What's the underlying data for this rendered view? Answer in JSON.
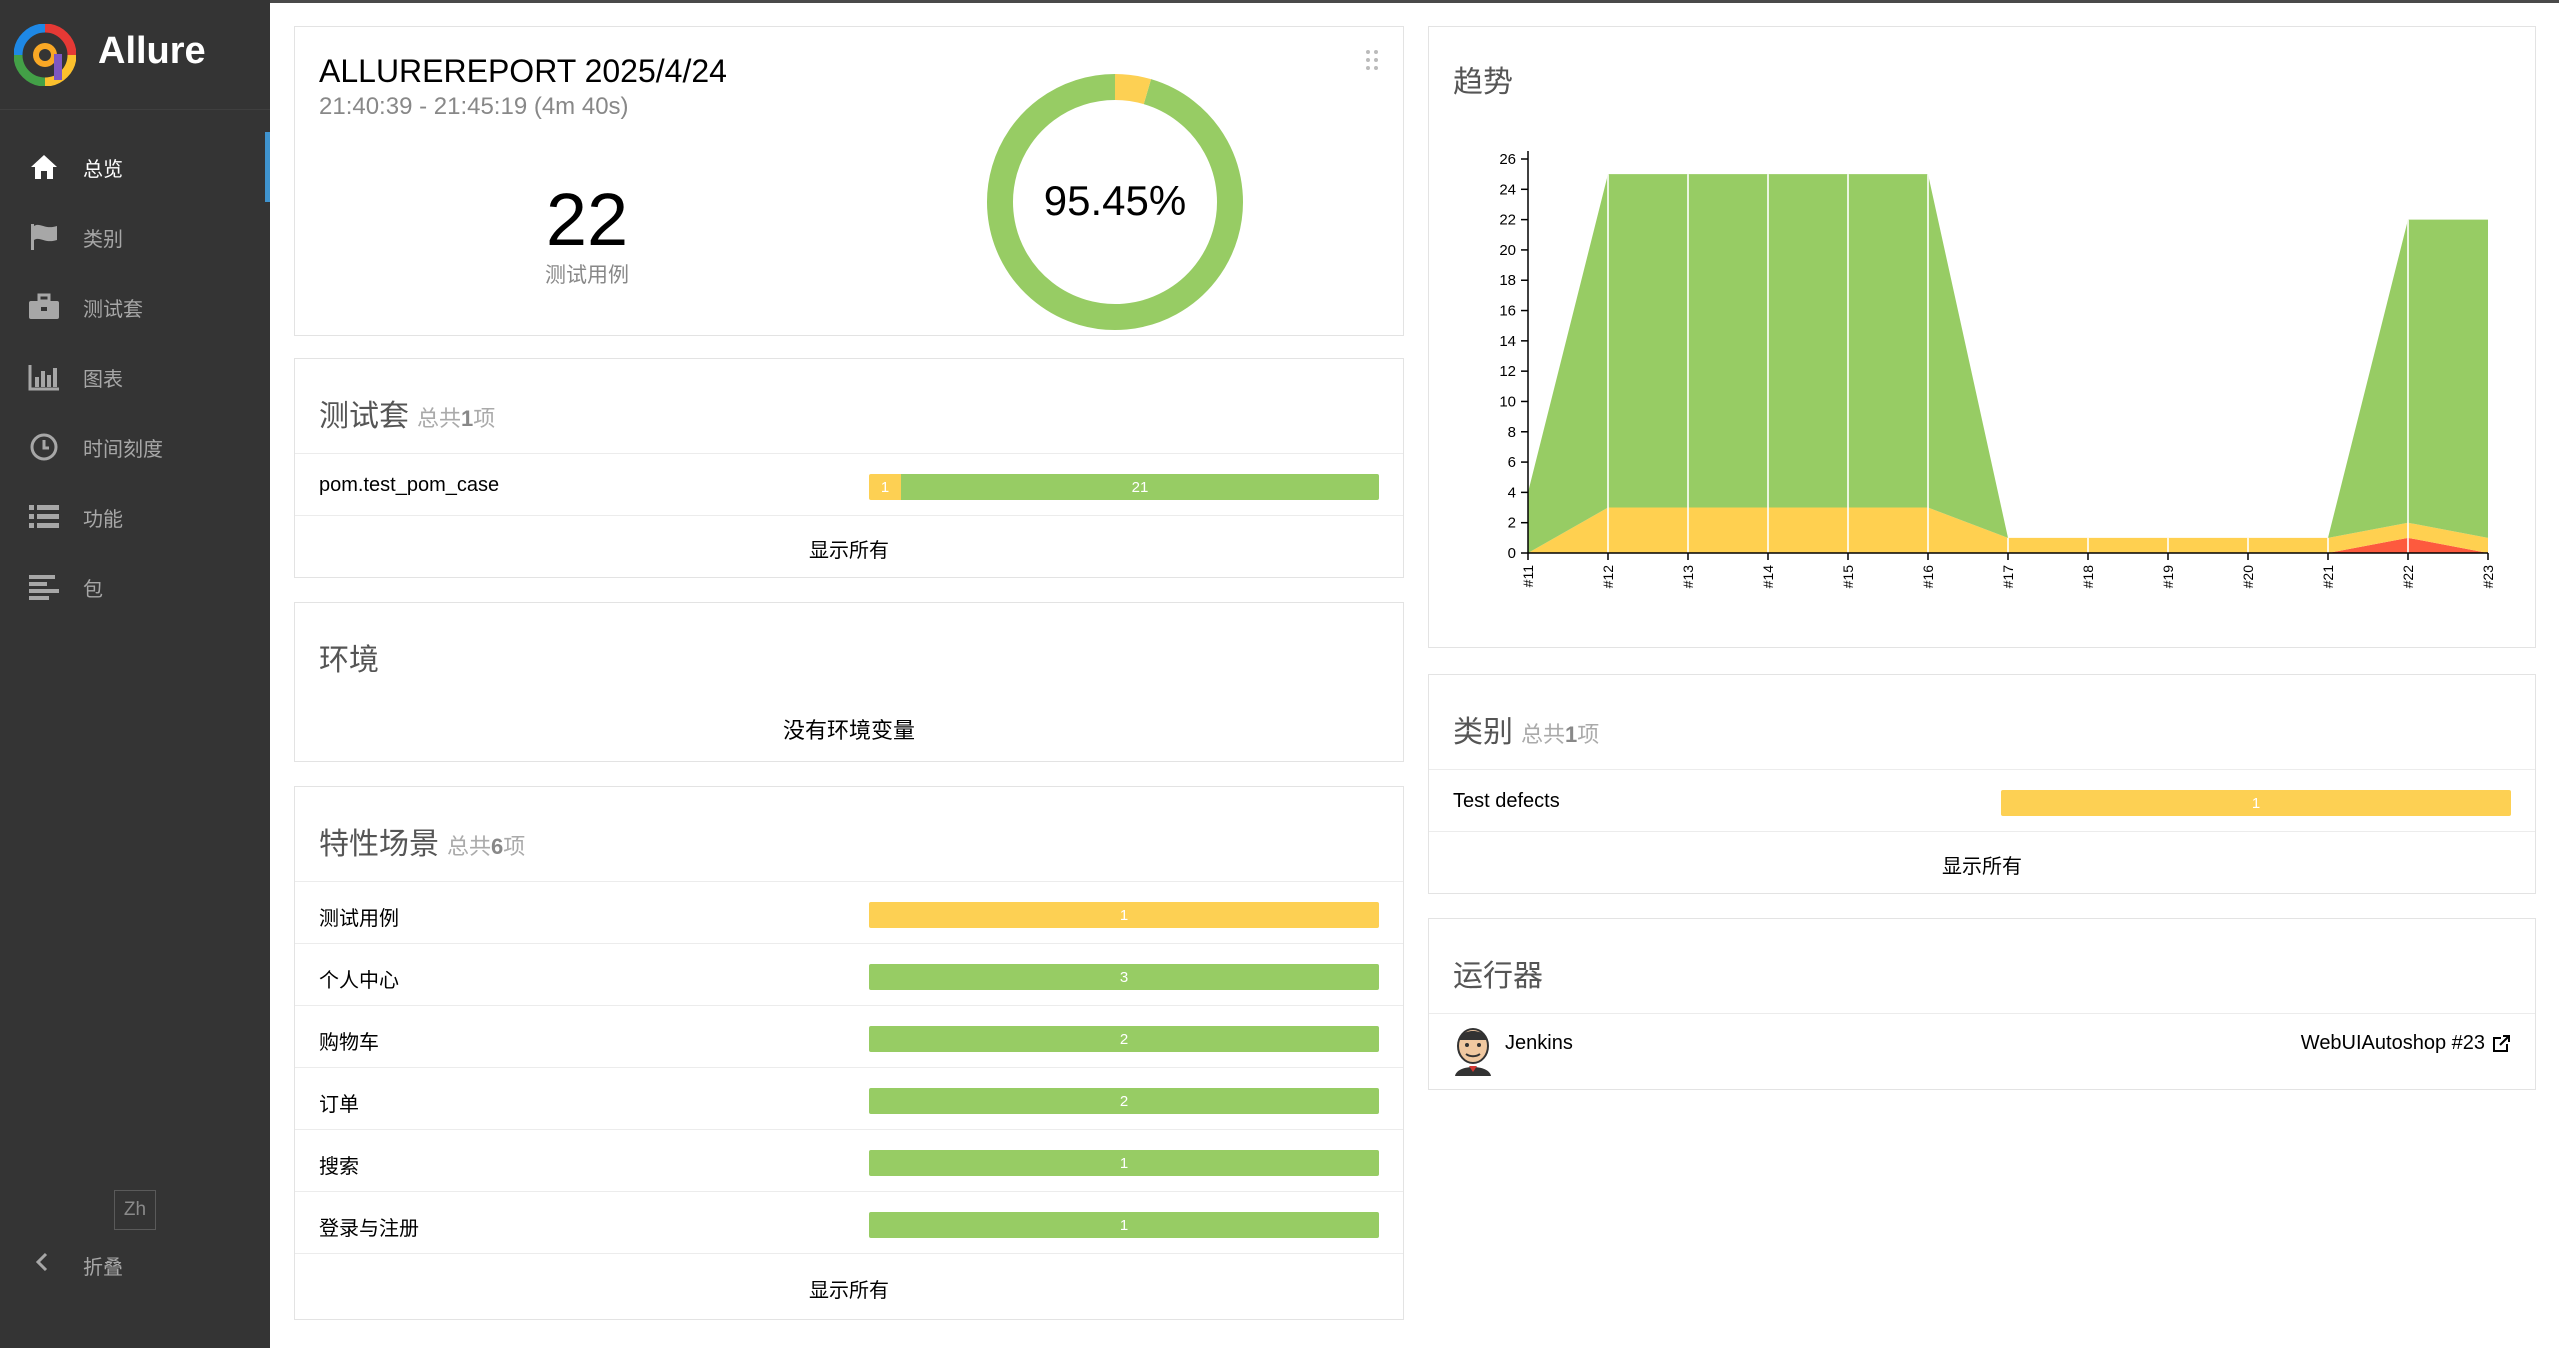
{
  "sidebar": {
    "brand": "Allure",
    "items": [
      {
        "label": "总览",
        "icon": "home-icon",
        "active": true
      },
      {
        "label": "类别",
        "icon": "flag-icon"
      },
      {
        "label": "测试套",
        "icon": "briefcase-icon"
      },
      {
        "label": "图表",
        "icon": "bar-chart-icon"
      },
      {
        "label": "时间刻度",
        "icon": "clock-icon"
      },
      {
        "label": "功能",
        "icon": "list-icon"
      },
      {
        "label": "包",
        "icon": "align-left-icon"
      }
    ],
    "language": "Zh",
    "collapse_label": "折叠"
  },
  "summary": {
    "title": "ALLUREREPORT 2025/4/24",
    "time_range": "21:40:39 - 21:45:19 (4m 40s)",
    "total": "22",
    "total_label": "测试用例",
    "pass_rate": "95.45%",
    "donut": {
      "passed": 21,
      "broken": 1
    }
  },
  "suites": {
    "title": "测试套",
    "count_prefix": "总共",
    "count": "1",
    "count_suffix": "项",
    "items": [
      {
        "label": "pom.test_pom_case",
        "broken": "1",
        "passed": "21"
      }
    ],
    "show_all": "显示所有"
  },
  "environment": {
    "title": "环境",
    "empty": "没有环境变量"
  },
  "features": {
    "title": "特性场景",
    "count_prefix": "总共",
    "count": "6",
    "count_suffix": "项",
    "items": [
      {
        "label": "测试用例",
        "value": "1",
        "status": "broken"
      },
      {
        "label": "个人中心",
        "value": "3",
        "status": "passed"
      },
      {
        "label": "购物车",
        "value": "2",
        "status": "passed"
      },
      {
        "label": "订单",
        "value": "2",
        "status": "passed"
      },
      {
        "label": "搜索",
        "value": "1",
        "status": "passed"
      },
      {
        "label": "登录与注册",
        "value": "1",
        "status": "passed"
      }
    ],
    "show_all": "显示所有"
  },
  "trend": {
    "title": "趋势"
  },
  "chart_data": {
    "type": "area",
    "x": [
      "#11",
      "#12",
      "#13",
      "#14",
      "#15",
      "#16",
      "#17",
      "#18",
      "#19",
      "#20",
      "#21",
      "#22",
      "#23"
    ],
    "series": [
      {
        "status": "failed",
        "color": "#fd5a3e",
        "values": [
          0,
          0,
          0,
          0,
          0,
          0,
          0,
          0,
          0,
          0,
          0,
          1,
          0
        ]
      },
      {
        "status": "broken",
        "color": "#ffd050",
        "values": [
          0,
          3,
          3,
          3,
          3,
          3,
          1,
          1,
          1,
          1,
          1,
          1,
          1
        ]
      },
      {
        "status": "passed",
        "color": "#97cc64",
        "values": [
          4,
          22,
          22,
          22,
          22,
          22,
          0,
          0,
          0,
          0,
          0,
          20,
          21
        ]
      }
    ],
    "yticks": [
      0,
      2,
      4,
      6,
      8,
      10,
      12,
      14,
      16,
      18,
      20,
      22,
      24,
      26
    ],
    "ylim": [
      0,
      26
    ]
  },
  "categories": {
    "title": "类别",
    "count_prefix": "总共",
    "count": "1",
    "count_suffix": "项",
    "items": [
      {
        "label": "Test defects",
        "value": "1"
      }
    ],
    "show_all": "显示所有"
  },
  "executors": {
    "title": "运行器",
    "name": "Jenkins",
    "link": "WebUIAutoshop #23"
  },
  "colors": {
    "passed": "#97cc64",
    "broken": "#fdd053",
    "failed": "#fd5a3e",
    "sidebar": "#343434",
    "accent": "#3f93ce"
  }
}
